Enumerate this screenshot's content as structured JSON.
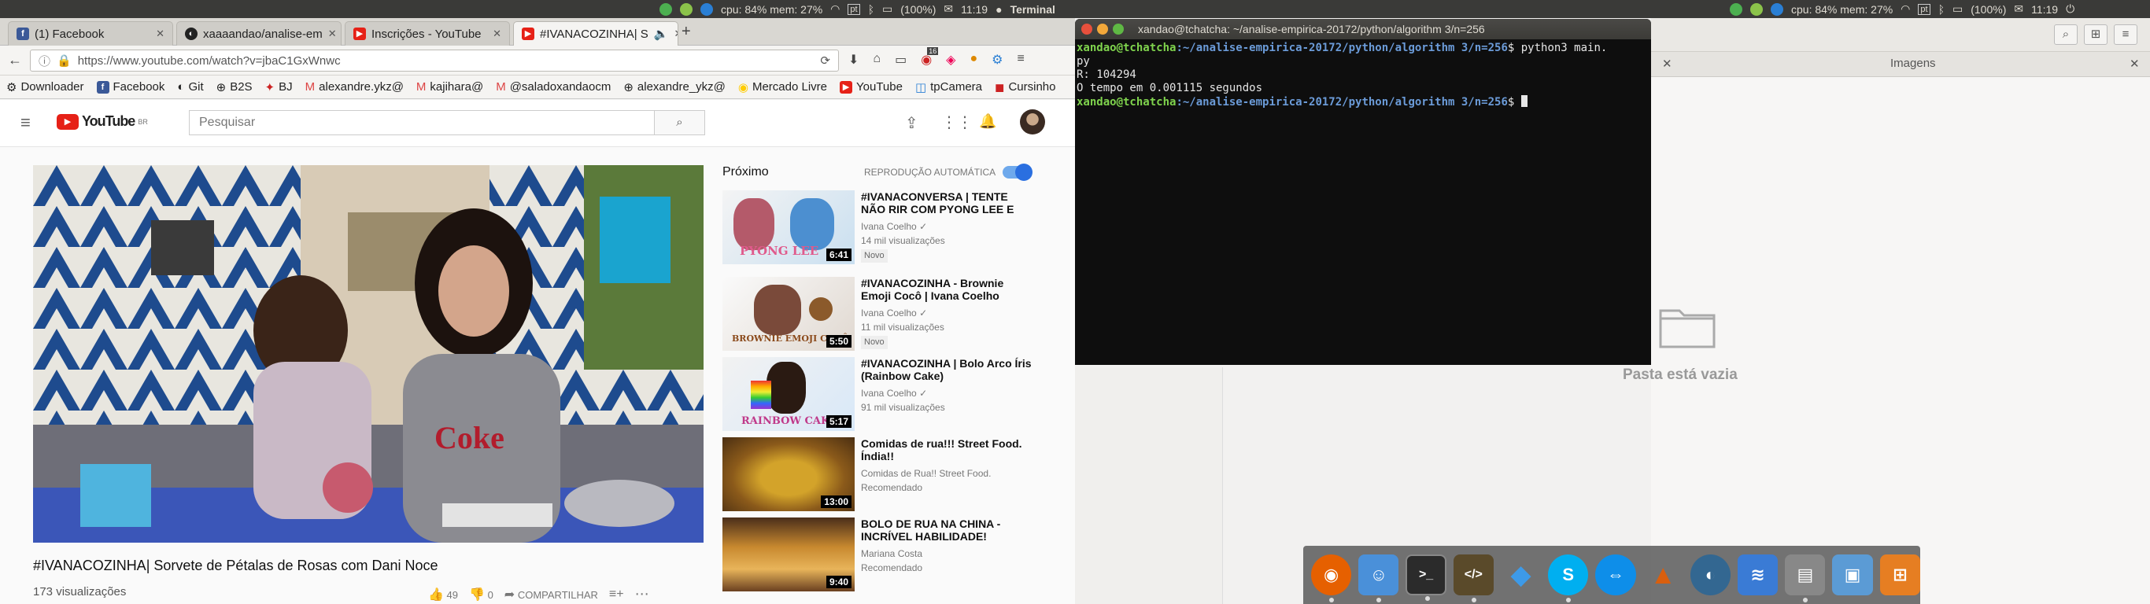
{
  "topbar": {
    "left_status": "cpu: 84% mem: 27%",
    "left_battery": "(100%)",
    "left_time": "11:19",
    "app_name": "Terminal",
    "right_status": "cpu: 84% mem: 27%",
    "right_battery": "(100%)",
    "right_time": "11:19"
  },
  "browser": {
    "tabs": [
      {
        "label": "(1) Facebook",
        "favicon": "facebook-icon",
        "color": "#3b5998"
      },
      {
        "label": "xaaaandao/analise-em",
        "favicon": "github-icon",
        "color": "#222222"
      },
      {
        "label": "Inscrições - YouTube",
        "favicon": "youtube-icon",
        "color": "#e62117"
      },
      {
        "label": "#IVANACOZINHA| S",
        "favicon": "youtube-icon",
        "color": "#e62117"
      }
    ],
    "url": "https://www.youtube.com/watch?v=jbaC1GxWnwc",
    "bookmarks": [
      {
        "label": "Downloader",
        "icon": "gear-icon"
      },
      {
        "label": "Facebook",
        "icon": "facebook-icon"
      },
      {
        "label": "Git",
        "icon": "github-icon"
      },
      {
        "label": "B2S",
        "icon": "globe-icon"
      },
      {
        "label": "BJ",
        "icon": "bj-icon"
      },
      {
        "label": "alexandre.ykz@",
        "icon": "gmail-icon"
      },
      {
        "label": "kajihara@",
        "icon": "gmail-icon"
      },
      {
        "label": "@saladoxandaocm",
        "icon": "gmail-icon"
      },
      {
        "label": "alexandre_ykz@",
        "icon": "globe-icon"
      },
      {
        "label": "Mercado Livre",
        "icon": "mercado-livre-icon"
      },
      {
        "label": "YouTube",
        "icon": "youtube-icon"
      },
      {
        "label": "tpCamera",
        "icon": "camera-icon"
      },
      {
        "label": "Cursinho",
        "icon": "cursinho-icon"
      }
    ],
    "addon_badge": "16"
  },
  "youtube": {
    "logo_text": "YouTube",
    "logo_sup": "BR",
    "search_placeholder": "Pesquisar",
    "video": {
      "title": "#IVANACOZINHA| Sorvete de Pétalas de Rosas com Dani Noce",
      "views": "173 visualizações",
      "likes": "49",
      "dislikes": "0",
      "share_label": "COMPARTILHAR",
      "shirt_text": "Coke"
    },
    "next_label": "Próximo",
    "autoplay_label": "REPRODUÇÃO AUTOMÁTICA",
    "recommendations": [
      {
        "title": "#IVANACONVERSA | TENTE NÃO RIR COM PYONG LEE E",
        "channel": "Ivana Coelho",
        "views": "14 mil visualizações",
        "badge": "Novo",
        "duration": "6:41",
        "thumb_text": "PYONG LEE"
      },
      {
        "title": "#IVANACOZINHA - Brownie Emoji Cocô | Ivana Coelho",
        "channel": "Ivana Coelho",
        "views": "11 mil visualizações",
        "badge": "Novo",
        "duration": "5:50",
        "thumb_text": "BROWNIE EMOJI COCÔ"
      },
      {
        "title": "#IVANACOZINHA | Bolo Arco Íris (Rainbow Cake)",
        "channel": "Ivana Coelho",
        "views": "91 mil visualizações",
        "badge": "",
        "duration": "5:17",
        "thumb_text": "RAINBOW CAKE"
      },
      {
        "title": "Comidas de rua!!! Street Food. Índia!!",
        "channel": "Comidas de Rua!! Street Food.",
        "views": "Recomendado",
        "badge": "",
        "duration": "13:00",
        "thumb_text": ""
      },
      {
        "title": "BOLO DE RUA NA CHINA - INCRÍVEL HABILIDADE!",
        "channel": "Mariana Costa",
        "views": "Recomendado",
        "badge": "",
        "duration": "9:40",
        "thumb_text": ""
      }
    ]
  },
  "terminal": {
    "title": "xandao@tchatcha: ~/analise-empirica-20172/python/algorithm 3/n=256",
    "prompt_user": "xandao@tchatcha",
    "prompt_path": ":~/analise-empirica-20172/python/algorithm 3/n=256",
    "command": "$ python3 main.",
    "command_wrap": "py",
    "output1": "R: 104294",
    "output2": "O tempo em 0.001115 segundos",
    "prompt_end": "$ "
  },
  "files": {
    "tab_label": "Imagens",
    "empty_text": "Pasta está vazia"
  },
  "dock": {
    "apps": [
      {
        "name": "firefox-icon",
        "color": "#e66000",
        "glyph": "◉"
      },
      {
        "name": "finder-icon",
        "color": "#4a90d9",
        "glyph": "☺"
      },
      {
        "name": "terminal-icon",
        "color": "#2b2b2b",
        "glyph": ">_"
      },
      {
        "name": "code-editor-icon",
        "color": "#5a4a2a",
        "glyph": "</>"
      },
      {
        "name": "dropbox-icon",
        "color": "#3d9ae8",
        "glyph": "◆"
      },
      {
        "name": "skype-icon",
        "color": "#00aff0",
        "glyph": "S"
      },
      {
        "name": "teamviewer-icon",
        "color": "#0e8ee9",
        "glyph": "⇔"
      },
      {
        "name": "matlab-icon",
        "color": "#d95f0e",
        "glyph": "▲"
      },
      {
        "name": "postgresql-icon",
        "color": "#336791",
        "glyph": "🐘"
      },
      {
        "name": "mysql-workbench-icon",
        "color": "#3a7bd5",
        "glyph": "≋"
      },
      {
        "name": "drive-icon",
        "color": "#888888",
        "glyph": "▤"
      },
      {
        "name": "virtualbox-icon",
        "color": "#5b9bd5",
        "glyph": "▣"
      },
      {
        "name": "network-icon",
        "color": "#e67e22",
        "glyph": "⊞"
      }
    ]
  },
  "colors": {
    "terminal_green": "#7fd34d",
    "terminal_blue": "#6b9bd8",
    "youtube_red": "#e62117",
    "autoplay_blue": "#2a6fe0"
  }
}
